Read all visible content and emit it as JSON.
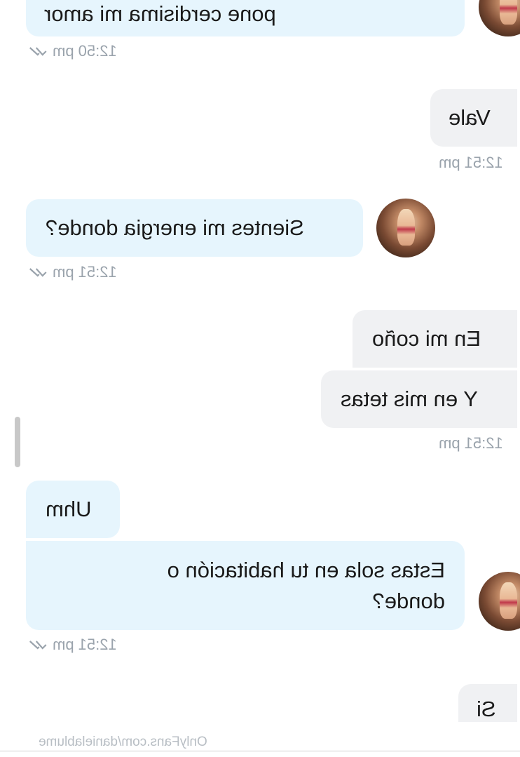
{
  "messages": [
    {
      "id": "m1",
      "side": "left",
      "text": "pone cerdisima mi amor"
    },
    {
      "id": "m2",
      "side": "right",
      "text": "Vale"
    },
    {
      "id": "m3",
      "side": "left",
      "text": "Sientes mi energia donde?"
    },
    {
      "id": "m4",
      "side": "right",
      "text": "En mi coño"
    },
    {
      "id": "m5",
      "side": "right",
      "text": "Y en mis tetas"
    },
    {
      "id": "m6",
      "side": "left",
      "text": "Uhm"
    },
    {
      "id": "m7",
      "side": "left",
      "text": "Estas sola en tu habitación o donde?"
    },
    {
      "id": "m8",
      "side": "right",
      "text": "Si"
    }
  ],
  "timestamps": {
    "t1": "12:50 pm",
    "t2": "12:51 pm",
    "t3": "12:51 pm",
    "t4": "12:51 pm",
    "t5": "12:51 pm"
  },
  "watermark": "OnlyFans.com/danielablume",
  "colors": {
    "left_bubble": "#e6f5fd",
    "right_bubble": "#f0f1f3",
    "timestamp": "#9aa3ac",
    "read_ticks": "#9aa3ac"
  },
  "icons": {
    "read_receipt": "double-check-icon",
    "avatar": "user-avatar"
  },
  "layout_note_mirrored": "image is horizontally mirrored"
}
